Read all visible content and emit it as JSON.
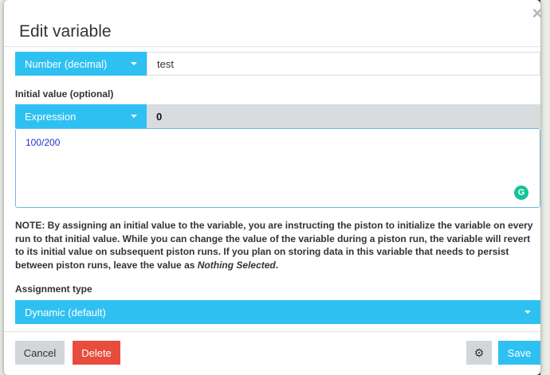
{
  "dialog": {
    "title": "Edit variable",
    "close_glyph": "×"
  },
  "variable": {
    "type_label": "Number (decimal)",
    "name_value": "test"
  },
  "initial_value": {
    "label": "Initial value (optional)",
    "mode_label": "Expression",
    "evaluated_value": "0",
    "expression_text": "100/200"
  },
  "note": {
    "prefix": "NOTE: By assigning an initial value to the variable, you are instructing the piston to initialize the variable on every run to that initial value. While you can change the value of the variable during a piston run, the variable will revert to its initial value on subsequent piston runs. If you plan on storing data in this variable that needs to persist between piston runs, leave the value as ",
    "emphasis": "Nothing Selected",
    "suffix": "."
  },
  "assignment": {
    "label": "Assignment type",
    "selected": "Dynamic (default)"
  },
  "footer": {
    "cancel_label": "Cancel",
    "delete_label": "Delete",
    "settings_icon_glyph": "⚙",
    "save_label": "Save"
  },
  "icons": {
    "grammarly_glyph": "G"
  },
  "colors": {
    "accent": "#2fc0f2",
    "danger": "#e74c3c",
    "neutral_button": "#d3d6d8",
    "expression_text": "#2233cc"
  }
}
